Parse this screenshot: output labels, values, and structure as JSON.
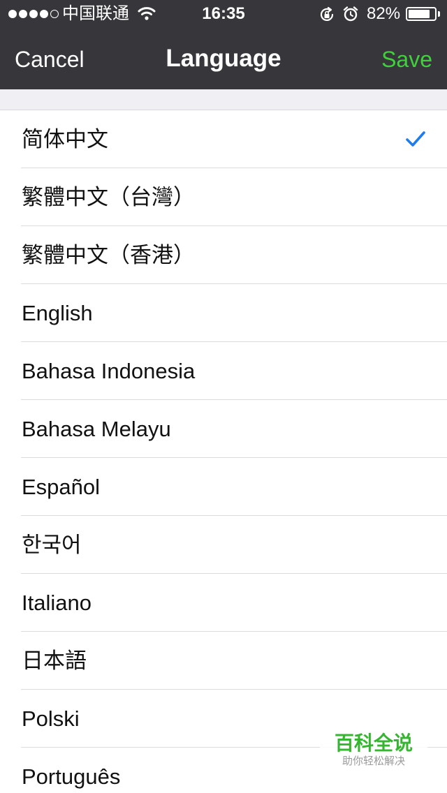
{
  "status_bar": {
    "carrier": "中国联通",
    "time": "16:35",
    "battery": "82%",
    "battery_level": 0.82
  },
  "nav": {
    "cancel_label": "Cancel",
    "title": "Language",
    "save_label": "Save",
    "save_color": "#3fd13b"
  },
  "languages": [
    {
      "label": "简体中文",
      "selected": true
    },
    {
      "label": "繁體中文（台灣）",
      "selected": false
    },
    {
      "label": "繁體中文（香港）",
      "selected": false
    },
    {
      "label": "English",
      "selected": false
    },
    {
      "label": "Bahasa Indonesia",
      "selected": false
    },
    {
      "label": "Bahasa Melayu",
      "selected": false
    },
    {
      "label": "Español",
      "selected": false
    },
    {
      "label": "한국어",
      "selected": false
    },
    {
      "label": "Italiano",
      "selected": false
    },
    {
      "label": "日本語",
      "selected": false
    },
    {
      "label": "Polski",
      "selected": false
    },
    {
      "label": "Português",
      "selected": false
    }
  ],
  "check_color": "#1e7cf0",
  "watermark": {
    "title": "百科全说",
    "subtitle": "助你轻松解决"
  }
}
